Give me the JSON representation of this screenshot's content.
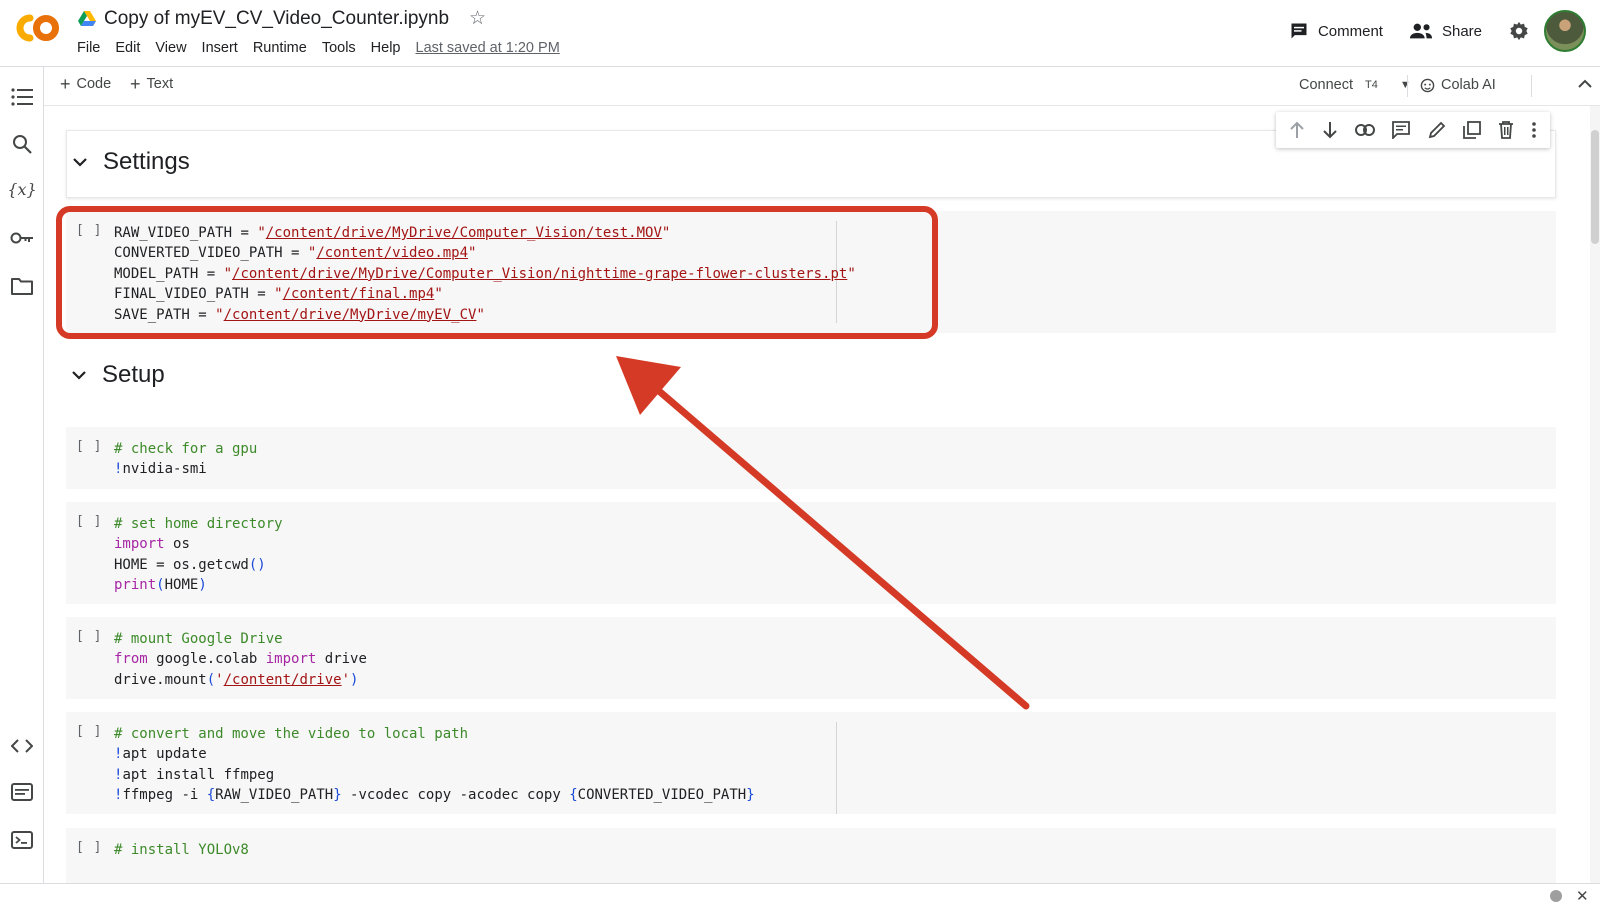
{
  "app": {
    "logo_text": "CO",
    "notebook_title": "Copy of myEV_CV_Video_Counter.ipynb",
    "menu": [
      "File",
      "Edit",
      "View",
      "Insert",
      "Runtime",
      "Tools",
      "Help"
    ],
    "last_saved": "Last saved at 1:20 PM",
    "comment_label": "Comment",
    "share_label": "Share"
  },
  "toolbar": {
    "add_code": "Code",
    "add_text": "Text",
    "connect": "Connect",
    "runtime_type": "T4",
    "colab_ai": "Colab AI"
  },
  "sections": {
    "settings_title": "Settings",
    "setup_title": "Setup"
  },
  "cells": {
    "run_slot": "[ ]",
    "settings": [
      {
        "var": "RAW_VIDEO_PATH",
        "value": "/content/drive/MyDrive/Computer_Vision/test.MOV"
      },
      {
        "var": "CONVERTED_VIDEO_PATH",
        "value": "/content/video.mp4"
      },
      {
        "var": "MODEL_PATH",
        "value": "/content/drive/MyDrive/Computer_Vision/nighttime-grape-flower-clusters.pt"
      },
      {
        "var": "FINAL_VIDEO_PATH",
        "value": "/content/final.mp4"
      },
      {
        "var": "SAVE_PATH",
        "value": "/content/drive/MyDrive/myEV_CV"
      }
    ],
    "gpu": {
      "comment": "# check for a gpu",
      "cmd": "nvidia-smi"
    },
    "home": {
      "comment": "# set home directory",
      "kw_import": "import",
      "module": "os",
      "line2_lhs": "HOME = os.getcwd",
      "print_fn": "print",
      "print_arg": "HOME"
    },
    "drive": {
      "comment": "# mount Google Drive",
      "kw_from": "from",
      "module": "google.colab",
      "kw_import": "import",
      "name": "drive",
      "call": "drive.mount",
      "path": "/content/drive"
    },
    "convert": {
      "comment": "# convert and move the video to local path",
      "line1": "apt update",
      "line2": "apt install ffmpeg",
      "cmd_prefix": "ffmpeg -i ",
      "arg1": "RAW_VIDEO_PATH",
      "cmd_mid": " -vcodec copy -acodec copy ",
      "arg2": "CONVERTED_VIDEO_PATH"
    },
    "yolo": {
      "comment": "# install YOLOv8"
    }
  },
  "colors": {
    "accent_orange": "#f9ab00",
    "annotation_red": "#d43a25",
    "keyword_purple": "#a626a4",
    "comment_green": "#3d8a2a",
    "string_red": "#a31515"
  },
  "icons": {
    "rail": [
      "toc-icon",
      "search-icon",
      "variables-icon",
      "key-icon",
      "folder-icon",
      "code-snippets-icon",
      "command-palette-icon",
      "terminal-icon"
    ],
    "cell_tools": [
      "move-up-icon",
      "move-down-icon",
      "link-icon",
      "comment-icon",
      "edit-icon",
      "mirror-cell-icon",
      "delete-icon",
      "more-vert-icon"
    ]
  }
}
